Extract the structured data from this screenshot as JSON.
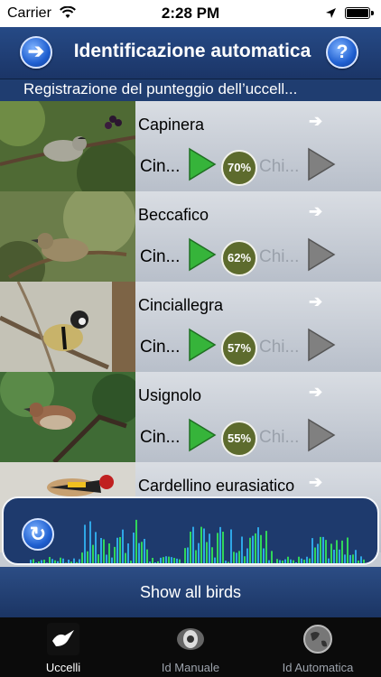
{
  "status_bar": {
    "carrier": "Carrier",
    "time": "2:28 PM"
  },
  "header": {
    "title": "Identificazione automatica",
    "back_icon": "left-arrow-icon",
    "help_label": "?"
  },
  "subtitle": "Registrazione del punteggio dell’uccell...",
  "birds": [
    {
      "name": "Capinera",
      "option1": "Cin...",
      "percent": "70%",
      "option2": "Chi..."
    },
    {
      "name": "Beccafico",
      "option1": "Cin...",
      "percent": "62%",
      "option2": "Chi..."
    },
    {
      "name": "Cinciallegra",
      "option1": "Cin...",
      "percent": "57%",
      "option2": "Chi..."
    },
    {
      "name": "Usignolo",
      "option1": "Cin...",
      "percent": "55%",
      "option2": "Chi..."
    },
    {
      "name": "Cardellino eurasiatico"
    }
  ],
  "show_all_label": "Show all birds",
  "tabs": [
    {
      "label": "Uccelli",
      "icon": "bird-icon",
      "active": true
    },
    {
      "label": "Id Manuale",
      "icon": "eye-icon",
      "active": false
    },
    {
      "label": "Id Automatica",
      "icon": "globe-icon",
      "active": false
    }
  ],
  "colors": {
    "accent_blue": "#1f5fd0",
    "header_bg": "#264a86",
    "play_green": "#36b43a",
    "badge_olive": "#5d6b2d"
  }
}
